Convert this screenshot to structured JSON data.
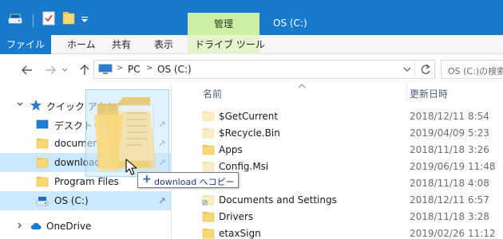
{
  "window": {
    "title": "OS (C:)",
    "context_tab": "管理"
  },
  "ribbon": {
    "tabs": [
      "ファイル",
      "ホーム",
      "共有",
      "表示",
      "ドライブ ツール"
    ]
  },
  "address": {
    "crumbs": [
      "PC",
      "OS (C:)"
    ],
    "search_placeholder": "OS (C:)の検索"
  },
  "nav_pane": {
    "items": [
      {
        "label": "クイック アクセス",
        "icon": "star-icon"
      },
      {
        "label": "デスクトップ",
        "icon": "desktop-icon"
      },
      {
        "label": "document",
        "icon": "folder-icon"
      },
      {
        "label": "download",
        "icon": "folder-icon"
      },
      {
        "label": "Program Files",
        "icon": "folder-icon"
      },
      {
        "label": "OS (C:)",
        "icon": "drive-icon"
      },
      {
        "label": "OneDrive",
        "icon": "cloud-icon"
      }
    ]
  },
  "file_list": {
    "columns": {
      "name": "名前",
      "date": "更新日時"
    },
    "rows": [
      {
        "name": "$GetCurrent",
        "date": "2018/12/11 8:54",
        "kind": "hidden"
      },
      {
        "name": "$Recycle.Bin",
        "date": "2019/04/09 5:23",
        "kind": "hidden"
      },
      {
        "name": "Apps",
        "date": "2018/11/18 3:26",
        "kind": "folder"
      },
      {
        "name": "Config.Msi",
        "date": "2019/06/19 11:48",
        "kind": "hidden"
      },
      {
        "name": "",
        "date": "2018/11/18 4:08",
        "kind": "folder"
      },
      {
        "name": "Documents and Settings",
        "date": "2018/12/11 6:57",
        "kind": "shortcut"
      },
      {
        "name": "Drivers",
        "date": "2018/11/18 3:28",
        "kind": "folder"
      },
      {
        "name": "etaxSign",
        "date": "2019/02/26 11:12",
        "kind": "folder"
      }
    ]
  },
  "drag": {
    "tooltip": "download へコピー",
    "plus": "+"
  },
  "colors": {
    "accent": "#1979ca",
    "context_tab": "#cdeea5",
    "selection": "#cce8ff",
    "folder": "#f8d775"
  }
}
